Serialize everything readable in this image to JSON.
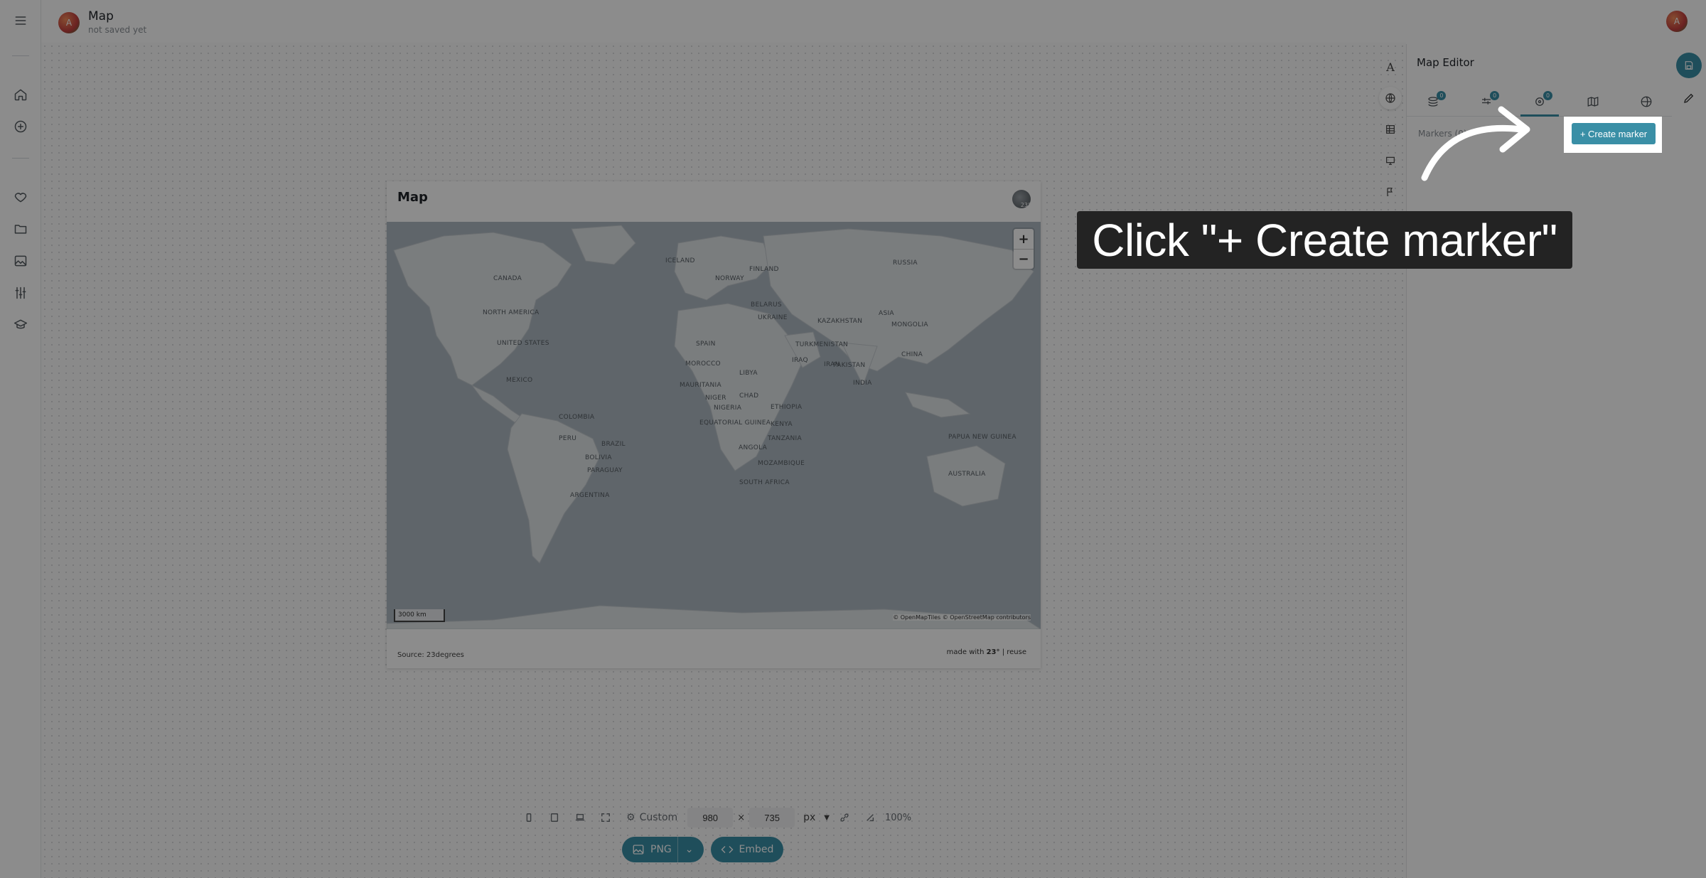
{
  "header": {
    "avatar_initial": "A",
    "title": "Map",
    "status": "not saved yet"
  },
  "left_rail": {
    "items": [
      {
        "name": "menu-icon"
      },
      {
        "name": "home-icon"
      },
      {
        "name": "add-circle-icon"
      },
      {
        "name": "heart-icon"
      },
      {
        "name": "folder-icon"
      },
      {
        "name": "image-icon"
      },
      {
        "name": "sliders-icon"
      },
      {
        "name": "graduation-cap-icon"
      }
    ]
  },
  "map_card": {
    "title": "Map",
    "logo_text": "23°",
    "zoom_in": "+",
    "zoom_out": "−",
    "scale": "3000 km",
    "attribution": "© OpenMapTiles © OpenStreetMap contributors",
    "source": "Source: 23degrees",
    "credit_prefix": "made with ",
    "credit_brand": "23°",
    "credit_sep": " | ",
    "credit_reuse": "reuse",
    "labels": [
      "ICELAND",
      "CANADA",
      "FINLAND",
      "NORWAY",
      "RUSSIA",
      "NORTH AMERICA",
      "BELARUS",
      "UKRAINE",
      "KAZAKHSTAN",
      "ASIA",
      "MONGOLIA",
      "UNITED STATES",
      "SPAIN",
      "TURKMENISTAN",
      "CHINA",
      "MOROCCO",
      "LIBYA",
      "IRAQ",
      "IRAN",
      "PAKISTAN",
      "MEXICO",
      "MAURITANIA",
      "NIGER",
      "CHAD",
      "INDIA",
      "NIGERIA",
      "ETHIOPIA",
      "EQUATORIAL GUINEA",
      "KENYA",
      "COLOMBIA",
      "PERU",
      "BRAZIL",
      "ANGOLA",
      "TANZANIA",
      "BOLIVIA",
      "MOZAMBIQUE",
      "PARAGUAY",
      "SOUTH AFRICA",
      "ARGENTINA",
      "AUSTRALIA",
      "PAPUA NEW GUINEA"
    ]
  },
  "size_toolbar": {
    "preset": "Custom",
    "width": "980",
    "times": "×",
    "height": "735",
    "unit": "px",
    "zoom": "100%"
  },
  "export": {
    "png": "PNG",
    "embed": "Embed"
  },
  "editor": {
    "title": "Map Editor",
    "tabs": [
      {
        "name": "layers",
        "badge": "0"
      },
      {
        "name": "filters",
        "badge": "0"
      },
      {
        "name": "markers",
        "badge": "0"
      },
      {
        "name": "basemap",
        "badge": ""
      },
      {
        "name": "globe",
        "badge": ""
      }
    ],
    "markers_label": "Markers (0)",
    "create_marker": "+ Create marker"
  },
  "tutorial": {
    "callout": "Click \"+ Create marker\""
  },
  "colors": {
    "accent": "#3a8fa6",
    "overlay": "#000000",
    "callout_bg": "#232323"
  }
}
